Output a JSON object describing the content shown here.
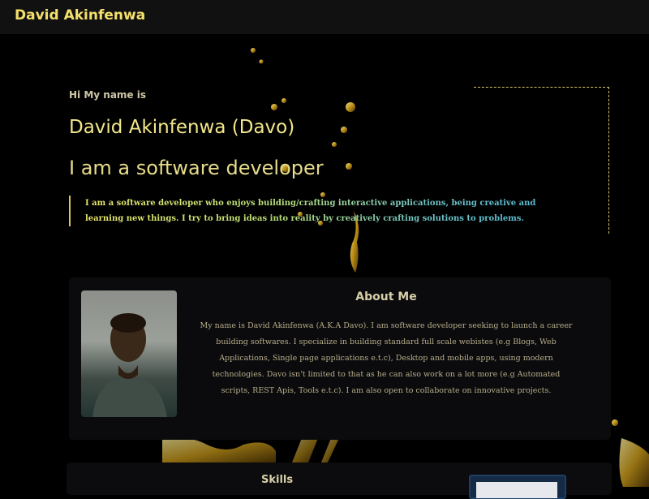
{
  "nav": {
    "brand": "David Akinfenwa"
  },
  "hero": {
    "greeting": "Hi My name is",
    "name": "David Akinfenwa (Davo)",
    "role": "I am a software developer",
    "quote": "I am a software developer who enjoys building/crafting interactive applications, being creative and learning new things. I try to bring ideas into reality by creatively crafting solutions to problems."
  },
  "about": {
    "title": "About Me",
    "text": "My name is David Akinfenwa (A.K.A Davo). I am software developer seeking to launch a career building softwares. I specialize in building standard full scale webistes (e.g Blogs, Web Applications, Single page applications e.t.c), Desktop and mobile apps, using modern technologies. Davo isn't limited to that as he can also work on a lot more (e.g Automated scripts, REST Apis, Tools e.t.c). I am also open to collaborate on innovative projects."
  },
  "skills": {
    "title": "Skills"
  },
  "colors": {
    "background": "#000000",
    "navbar": "#111112",
    "brand": "#f5e06a",
    "accent_gold": "#d9c45a",
    "card": "#0b0b0d"
  }
}
